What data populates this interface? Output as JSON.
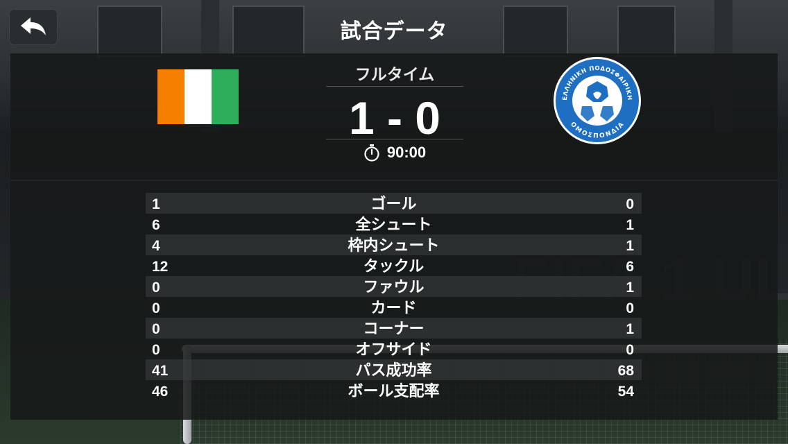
{
  "header": {
    "title": "試合データ"
  },
  "match": {
    "period": "フルタイム",
    "score": "1 - 0",
    "time": "90:00",
    "home_flag_colors": [
      "#f77f00",
      "#ffffff",
      "#2eae5a"
    ],
    "away_crest": {
      "top_text": "ΕΛΛΗΝΙΚΗ ΠΟΔΟΣΦΑΙΡΙΚΗ",
      "bottom_text": "ΟΜΟΣΠΟΝΔΙΑ",
      "color": "#1e6fc2"
    }
  },
  "stats": [
    {
      "home": "1",
      "label": "ゴール",
      "away": "0"
    },
    {
      "home": "6",
      "label": "全シュート",
      "away": "1"
    },
    {
      "home": "4",
      "label": "枠内シュート",
      "away": "1"
    },
    {
      "home": "12",
      "label": "タックル",
      "away": "6"
    },
    {
      "home": "0",
      "label": "ファウル",
      "away": "1"
    },
    {
      "home": "0",
      "label": "カード",
      "away": "0"
    },
    {
      "home": "0",
      "label": "コーナー",
      "away": "1"
    },
    {
      "home": "0",
      "label": "オフサイド",
      "away": "0"
    },
    {
      "home": "41",
      "label": "パス成功率",
      "away": "68"
    },
    {
      "home": "46",
      "label": "ボール支配率",
      "away": "54"
    }
  ],
  "icons": {
    "back": "back-arrow-icon",
    "clock": "stopwatch-icon"
  }
}
